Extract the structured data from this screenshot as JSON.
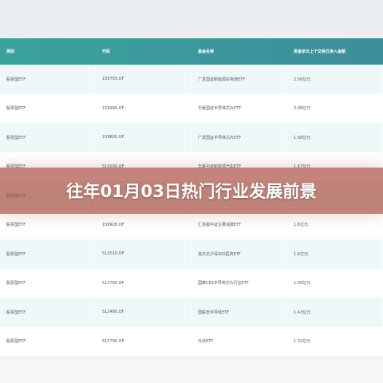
{
  "table": {
    "headers": {
      "type": "类别",
      "code": "代码",
      "name": "基金名称",
      "flow": "资金单日上个交易日净入金额"
    },
    "rows": [
      {
        "type": "股票型ETF",
        "code": "159755.OF",
        "name": "广发国证新能源车电池ETF",
        "flow": "2.56亿元"
      },
      {
        "type": "股票型ETF",
        "code": "159995.OF",
        "name": "华夏国证半导体芯片ETF",
        "flow": "2.08亿元"
      },
      {
        "type": "股票型ETF",
        "code": "159801.OF",
        "name": "广发国证半导体芯片ETF",
        "flow": "1.68亿元"
      },
      {
        "type": "股票型ETF",
        "code": "515030.OF",
        "name": "华夏中证新能源汽车ETF",
        "flow": "1.67亿元"
      },
      {
        "type": "股票型ETF",
        "code": "",
        "name": "",
        "flow": ""
      },
      {
        "type": "股票型ETF",
        "code": "159928.OF",
        "name": "汇添富中证主要消费ETF",
        "flow": "1.6亿元"
      },
      {
        "type": "股票型ETF",
        "code": "512010.OF",
        "name": "易方达沪深300医药ETF",
        "flow": "1.6亿元"
      },
      {
        "type": "股票型ETF",
        "code": "512760.OF",
        "name": "国泰CES半导体芯片行业ETF",
        "flow": "1.56亿元"
      },
      {
        "type": "股票型ETF",
        "code": "512480.OF",
        "name": "国联安半导体ETF",
        "flow": "1.43亿元"
      },
      {
        "type": "股票型ETF",
        "code": "515790.OF",
        "name": "光伏ETF",
        "flow": "1.32亿元"
      }
    ]
  },
  "banner": {
    "title": "往年01月03日热门行业发展前景"
  }
}
